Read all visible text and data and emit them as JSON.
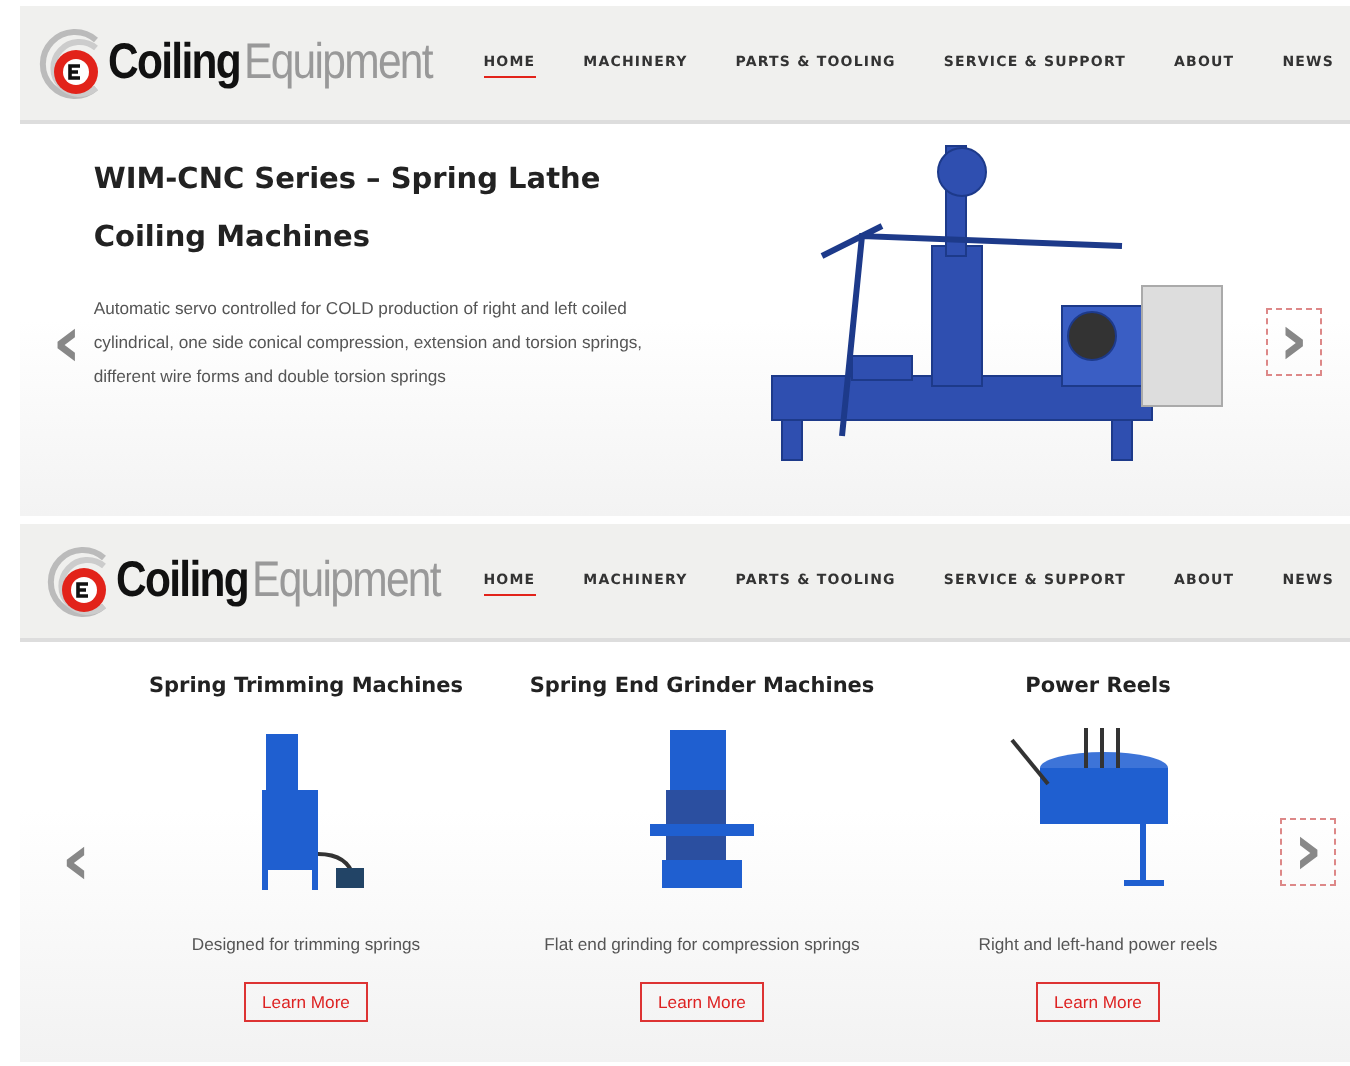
{
  "header_top": {
    "logo": {
      "word_1": "Coiling",
      "word_2": "Equipment"
    },
    "nav": [
      {
        "label": "HOME",
        "selected": true
      },
      {
        "label": "MACHINERY",
        "selected": false
      },
      {
        "label": "PARTS & TOOLING",
        "selected": false
      },
      {
        "label": "SERVICE & SUPPORT",
        "selected": false
      },
      {
        "label": "ABOUT",
        "selected": false
      },
      {
        "label": "NEWS",
        "selected": false
      }
    ]
  },
  "hero": {
    "title": "WIM-CNC Series – Spring Lathe Coiling Machines",
    "description": "Automatic servo controlled for COLD production of right and left coiled cylindrical, one side conical compression, extension and torsion springs, different wire forms and double torsion springs",
    "prev": "‹",
    "next": "›"
  },
  "header_bottom": {
    "logo": {
      "word_1": "Coiling",
      "word_2": "Equipment"
    },
    "nav": [
      {
        "label": "HOME",
        "selected": true
      },
      {
        "label": "MACHINERY",
        "selected": false
      },
      {
        "label": "PARTS & TOOLING",
        "selected": false
      },
      {
        "label": "SERVICE & SUPPORT",
        "selected": false
      },
      {
        "label": "ABOUT",
        "selected": false
      },
      {
        "label": "NEWS",
        "selected": false
      }
    ]
  },
  "products": {
    "prev": "‹",
    "next": "›",
    "items": [
      {
        "title": "Spring Trimming Machines",
        "description": "Designed for trimming springs",
        "button": "Learn More"
      },
      {
        "title": "Spring End Grinder Machines",
        "description": "Flat end grinding for compression springs",
        "button": "Learn More"
      },
      {
        "title": "Power Reels",
        "description": "Right and left-hand power reels",
        "button": "Learn More"
      }
    ]
  }
}
